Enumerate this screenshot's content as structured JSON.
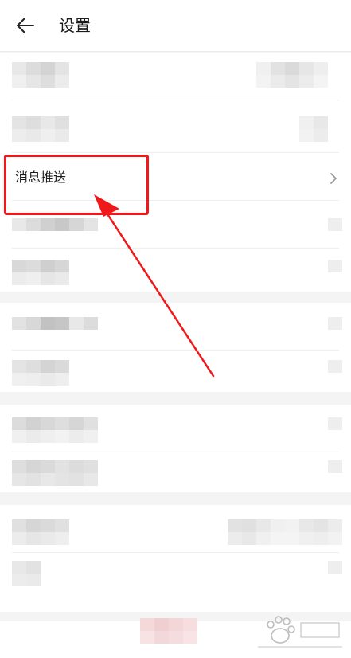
{
  "header": {
    "title": "设置",
    "back_icon": "arrow-left-icon"
  },
  "settings": {
    "highlighted_item": {
      "label": "消息推送",
      "chevron_icon": "chevron-right-icon"
    }
  },
  "annotation": {
    "color": "#f01818"
  },
  "colors": {
    "background": "#f4f4f4",
    "surface": "#ffffff",
    "text": "#1a1a1a",
    "chevron": "#9a9a9a"
  }
}
